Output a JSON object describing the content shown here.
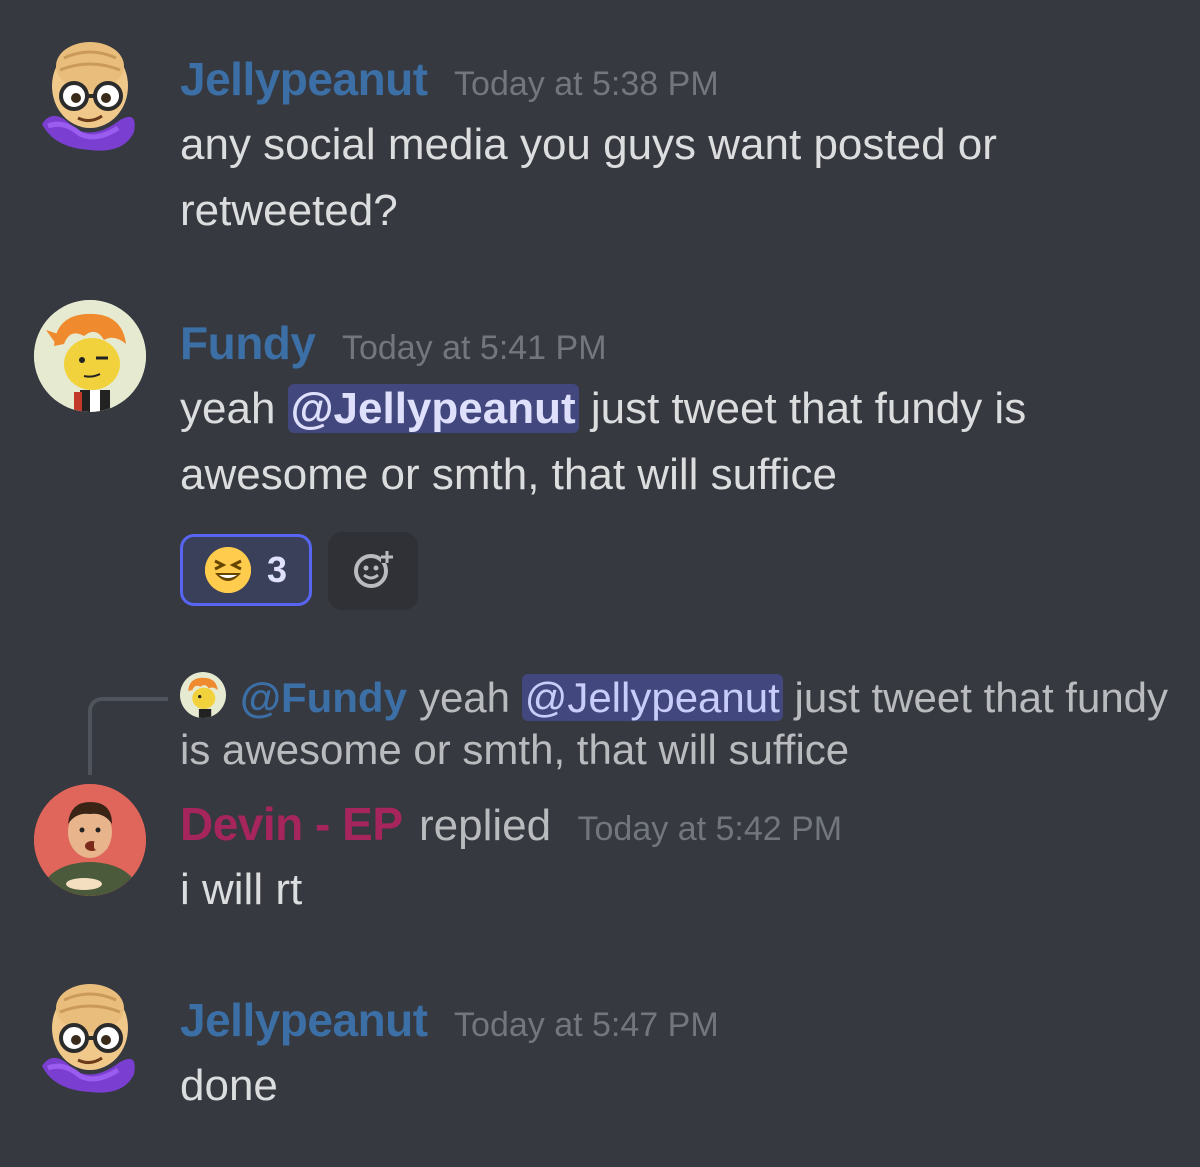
{
  "messages": [
    {
      "author": "Jellypeanut",
      "author_color": "#3b6fa5",
      "timestamp": "Today at 5:38 PM",
      "text": "any social media you guys want posted or retweeted?"
    },
    {
      "author": "Fundy",
      "author_color": "#3b6fa5",
      "timestamp": "Today at 5:41 PM",
      "text_before": "yeah ",
      "mention": "@Jellypeanut",
      "text_after": " just tweet that fundy is awesome or smth, that will suffice",
      "reactions": [
        {
          "emoji": "laughing-face-icon",
          "count": "3",
          "selected": true
        }
      ],
      "add_reaction_icon": "add-reaction-icon"
    },
    {
      "author": "Devin - EP",
      "author_color": "#a6255c",
      "replied_label": "replied",
      "timestamp": "Today at 5:42 PM",
      "text": "i will rt",
      "reply_to": {
        "author": "@Fundy",
        "text_before": "yeah ",
        "mention": "@Jellypeanut",
        "text_after": " just tweet that fundy is awesome or smth, that will suffice"
      }
    },
    {
      "author": "Jellypeanut",
      "author_color": "#3b6fa5",
      "timestamp": "Today at 5:47 PM",
      "text": "done"
    }
  ],
  "colors": {
    "background": "#36393f",
    "timestamp": "#72767d",
    "text": "#dcddde",
    "mention_bg": "#4a4f7a",
    "reaction_border": "#5865f2"
  }
}
